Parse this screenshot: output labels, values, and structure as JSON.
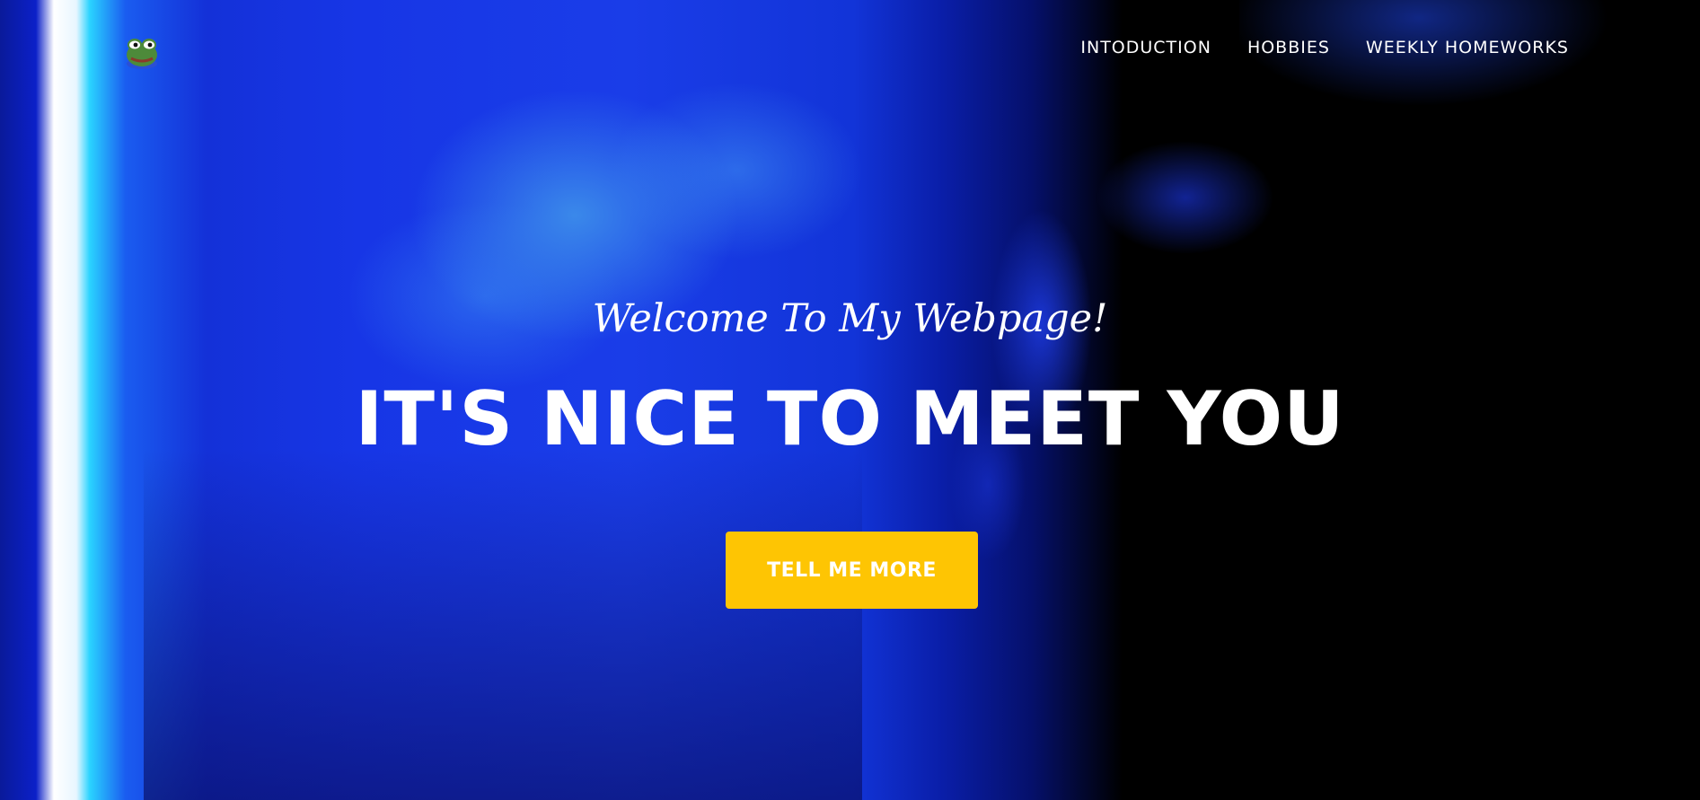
{
  "nav": {
    "logo_icon": "frog-icon",
    "links": [
      {
        "label": "INTODUCTION"
      },
      {
        "label": "HOBBIES"
      },
      {
        "label": "WEEKLY HOMEWORKS"
      }
    ]
  },
  "hero": {
    "subheading": "Welcome To My Webpage!",
    "heading": "IT'S NICE TO MEET YOU",
    "cta_label": "TELL ME MORE"
  },
  "colors": {
    "accent": "#fec503",
    "text": "#ffffff",
    "background_blue": "#1736e6"
  }
}
